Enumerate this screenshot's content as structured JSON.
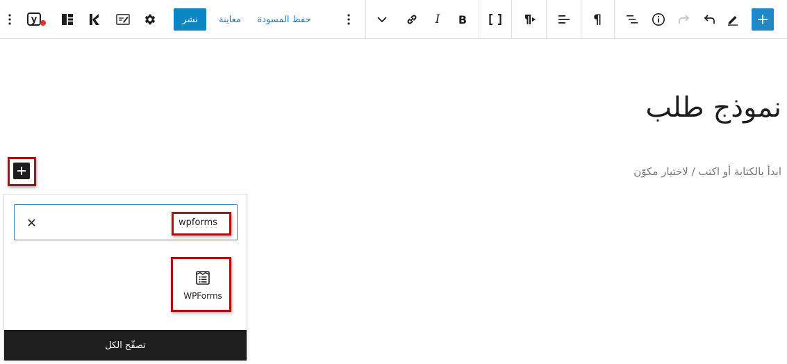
{
  "toolbar": {
    "publish_label": "نشر",
    "preview_label": "معاينة",
    "save_draft_label": "حفظ المسودة",
    "yoast_icon_label": "y",
    "bold_label": "B",
    "italic_label": "I",
    "paragraph_mark": "¶",
    "shortcode_label": "[ ]"
  },
  "post": {
    "title": "نموذج طلب",
    "placeholder": "ابدأ بالكتابة أو اكتب / لاختيار مكوّن"
  },
  "inserter": {
    "search_value": "wpforms",
    "clear_label": "×",
    "block_label": "WPForms",
    "browse_all_label": "تصفّح الكل"
  },
  "colors": {
    "accent": "#1e88c9",
    "publish": "#0b86c2",
    "highlight": "#b10f0f",
    "dark": "#1e1e1e"
  }
}
